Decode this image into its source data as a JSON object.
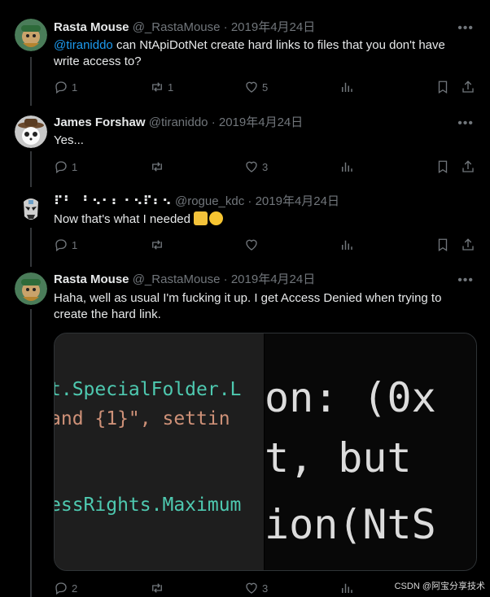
{
  "tweets": [
    {
      "name": "Rasta Mouse",
      "handle": "@_RastaMouse",
      "date": "2019年4月24日",
      "mention": "@tiranidd o",
      "text": " can NtApiDotNet create hard links to files that you don't have write access to?",
      "actions": {
        "reply": "1",
        "retweet": "1",
        "like": "5"
      }
    },
    {
      "name": "James Forshaw",
      "handle": "@tiraniddo",
      "date": "2019年4月24日",
      "text": "Yes...",
      "actions": {
        "reply": "1",
        "retweet": "",
        "like": "3"
      }
    },
    {
      "name": "⠏⠃⠀⠃⠢⠂⠆ ⠂⠢⠏⠆⠢",
      "handle": "@rogue_kdc",
      "date": "2019年4月24日",
      "text": "Now that's what I needed ",
      "actions": {
        "reply": "1",
        "retweet": "",
        "like": ""
      }
    },
    {
      "name": "Rasta Mouse",
      "handle": "@_RastaMouse",
      "date": "2019年4月24日",
      "text": "Haha, well as usual I'm fucking it up.  I get Access Denied when trying to create the hard link.",
      "actions": {
        "reply": "2",
        "retweet": "",
        "like": "3"
      }
    }
  ],
  "media": {
    "left_lines": [
      "t.SpecialFolder.L",
      " and {1}\", settin",
      "essRights.Maximum"
    ],
    "right_lines": [
      "on: (0x",
      "t, but",
      "ion(NtS"
    ]
  },
  "separator": "·",
  "watermark": "CSDN @阿宝分享技术",
  "colors": {
    "accent": "#1d9bf0",
    "muted": "#71767b",
    "text": "#e7e9ea",
    "background": "#000000"
  }
}
